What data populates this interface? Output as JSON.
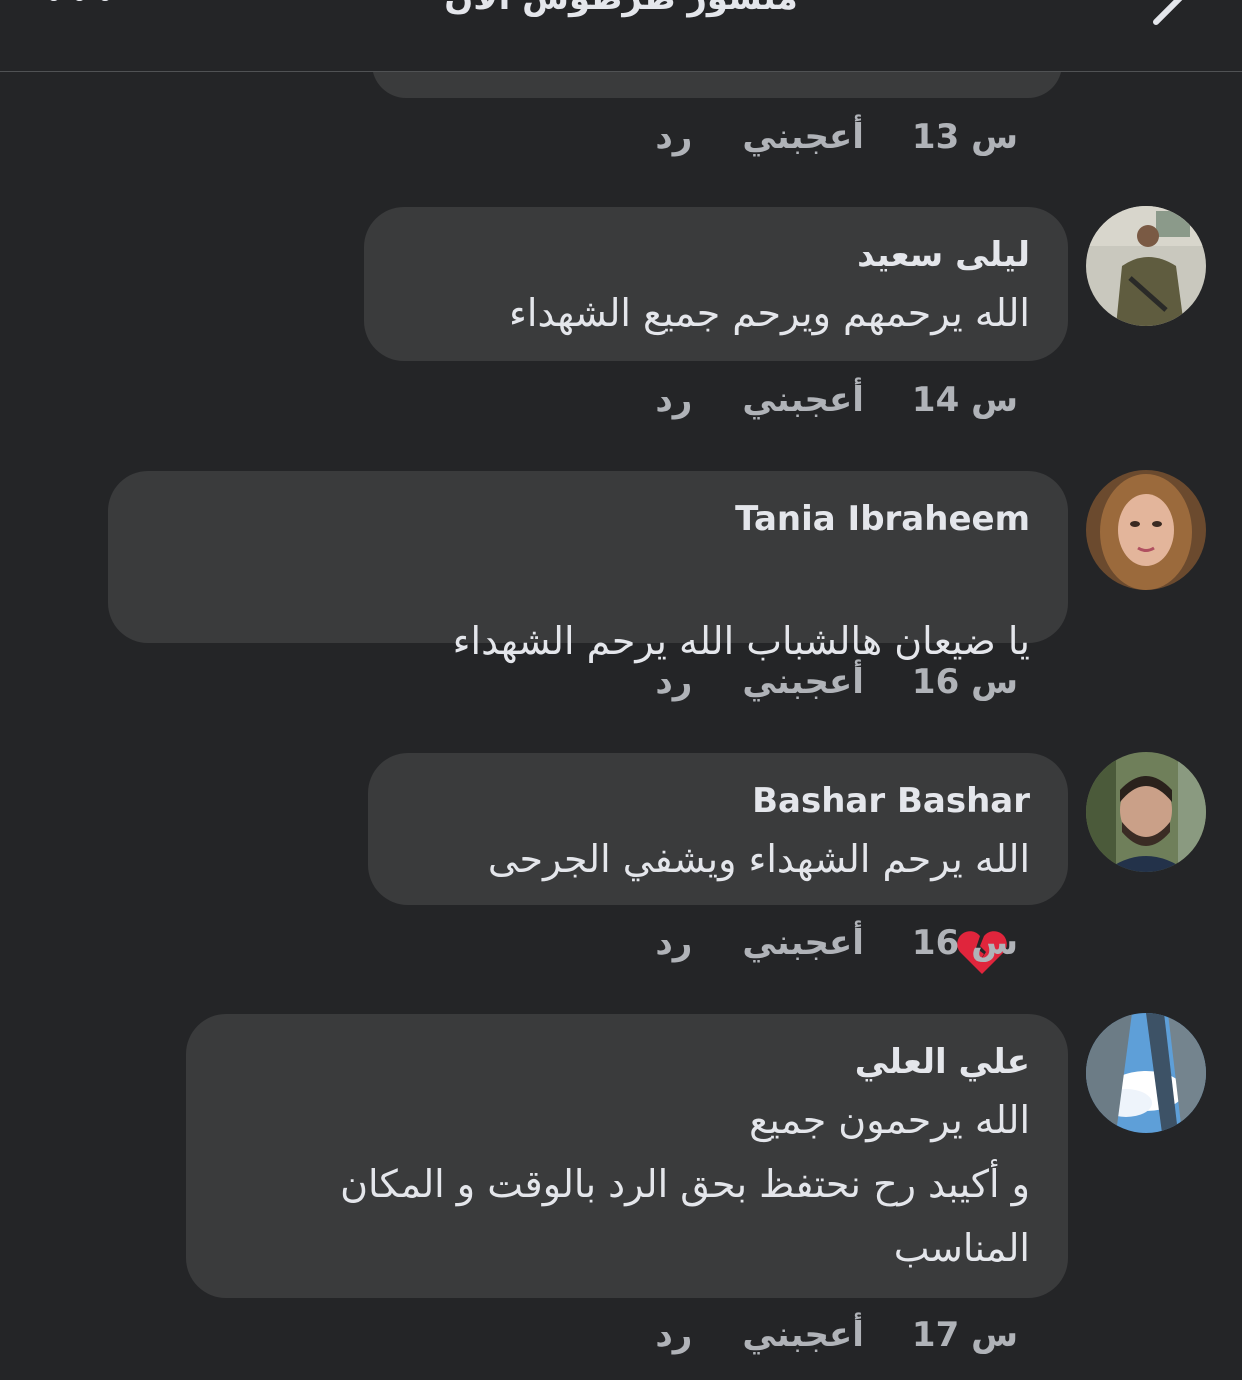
{
  "header": {
    "title": "منشور طرطوس الآن",
    "more_icon": "more-icon",
    "edit_icon": "pencil-icon"
  },
  "prev_comment": {
    "time": "13 س",
    "like_label": "أعجبني",
    "reply_label": "رد"
  },
  "comments": [
    {
      "name": "ليلى سعيد",
      "text": "الله يرحمهم ويرحم جميع الشهداء",
      "time": "14 س",
      "like_label": "أعجبني",
      "reply_label": "رد"
    },
    {
      "name": "Tania Ibraheem",
      "text": "يا ضيعان هالشباب الله يرحم الشهداء",
      "emoji": "broken-heart-icon ×3",
      "time": "16 س",
      "like_label": "أعجبني",
      "reply_label": "رد"
    },
    {
      "name": "Bashar Bashar",
      "text": "الله يرحم الشهداء ويشفي الجرحى",
      "time": "16 س",
      "like_label": "أعجبني",
      "reply_label": "رد"
    },
    {
      "name": "علي العلي",
      "text": "الله يرحمون جميع\nو أكيبد رح نحتفظ بحق الرد بالوقت و المكان المناسب",
      "time": "17 س",
      "like_label": "أعجبني",
      "reply_label": "رد"
    }
  ],
  "colors": {
    "background": "#242527",
    "bubble": "#3a3b3c",
    "meta_text": "#b0b3b8",
    "heart": "#e0253c"
  }
}
